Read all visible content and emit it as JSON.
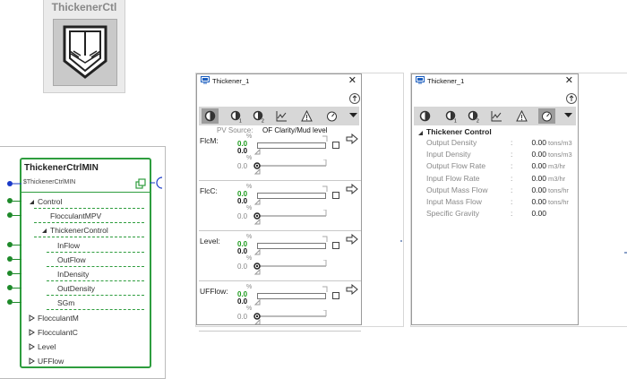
{
  "library_tile": {
    "title": "ThickenerCtl"
  },
  "faceplate": {
    "title": "ThickenerCtrlMIN",
    "subtitle": "$ThickenerCtrlMIN",
    "rows": [
      {
        "label": "Control",
        "indent": 0,
        "expand": "open",
        "pin": true
      },
      {
        "label": "FlocculantMPV",
        "indent": 1,
        "expand": "none",
        "pin": true
      },
      {
        "label": "ThickenerControl",
        "indent": 1,
        "expand": "open",
        "pin": false
      },
      {
        "label": "InFlow",
        "indent": 2,
        "expand": "none",
        "pin": true
      },
      {
        "label": "OutFlow",
        "indent": 2,
        "expand": "none",
        "pin": true
      },
      {
        "label": "InDensity",
        "indent": 2,
        "expand": "none",
        "pin": true
      },
      {
        "label": "OutDensity",
        "indent": 2,
        "expand": "none",
        "pin": true
      },
      {
        "label": "SGm",
        "indent": 2,
        "expand": "none",
        "pin": true
      },
      {
        "label": "FlocculantM",
        "indent": 0,
        "expand": "closed",
        "pin": false
      },
      {
        "label": "FlocculantC",
        "indent": 0,
        "expand": "closed",
        "pin": false
      },
      {
        "label": "Level",
        "indent": 0,
        "expand": "closed",
        "pin": false
      },
      {
        "label": "UFFlow",
        "indent": 0,
        "expand": "closed",
        "pin": false
      }
    ]
  },
  "window1": {
    "title": "Thickener_1",
    "close": "✕",
    "pv_source_label": "PV Source:",
    "pv_source_value": "OF Clarity/Mud level",
    "tabs": [
      "main",
      "loop1",
      "loop2",
      "trend",
      "alarm",
      "gauge",
      "more"
    ],
    "active_tab": 0,
    "loops": [
      {
        "label": "FlcM:",
        "pct": "%",
        "pv": "0.0",
        "sp": "0.0",
        "out": "0.0"
      },
      {
        "label": "FlcC:",
        "pct": "%",
        "pv": "0.0",
        "sp": "0.0",
        "out": "0.0"
      },
      {
        "label": "Level:",
        "pct": "%",
        "pv": "0.0",
        "sp": "0.0",
        "out": "0.0"
      },
      {
        "label": "UFFlow:",
        "pct": "%",
        "pv": "0.0",
        "sp": "0.0",
        "out": "0.0"
      }
    ]
  },
  "window2": {
    "title": "Thickener_1",
    "close": "✕",
    "tabs": [
      "main",
      "loop1",
      "loop2",
      "trend",
      "alarm",
      "gauge",
      "more"
    ],
    "active_tab": 5,
    "section_title": "Thickener Control",
    "rows": [
      {
        "label": "Output Density",
        "value": "0.00",
        "unit": "tons/m3"
      },
      {
        "label": "Input Density",
        "value": "0.00",
        "unit": "tons/m3"
      },
      {
        "label": "Output Flow Rate",
        "value": "0.00",
        "unit": "m3/hr"
      },
      {
        "label": "Input Flow Rate",
        "value": "0.00",
        "unit": "m3/hr"
      },
      {
        "label": "Output Mass Flow",
        "value": "0.00",
        "unit": "tons/hr"
      },
      {
        "label": "Input Mass Flow",
        "value": "0.00",
        "unit": "tons/hr"
      },
      {
        "label": "Specific Gravity",
        "value": "0.00",
        "unit": ""
      }
    ]
  },
  "colors": {
    "accent_green": "#2e9d3e",
    "value_green": "#1a9a1a",
    "toolbar_gray": "#d7d7d7",
    "active_tab": "#9c9c9c"
  }
}
